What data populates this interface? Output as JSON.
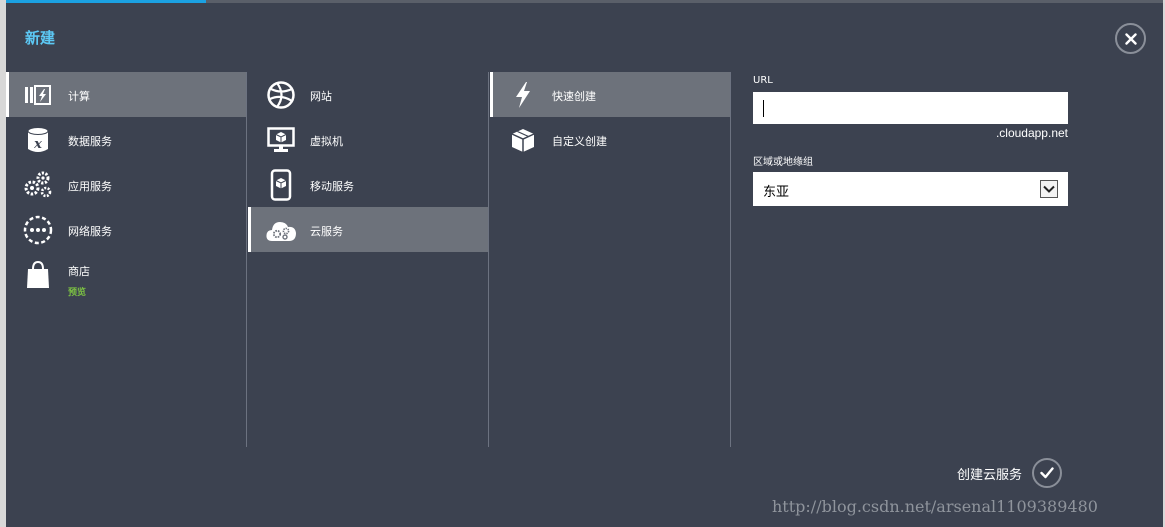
{
  "dialog": {
    "title": "新建"
  },
  "categories": [
    {
      "label": "计算",
      "icon": "compute-icon",
      "selected": true
    },
    {
      "label": "数据服务",
      "icon": "data-services-icon"
    },
    {
      "label": "应用服务",
      "icon": "app-services-icon"
    },
    {
      "label": "网络服务",
      "icon": "network-services-icon"
    },
    {
      "label": "商店",
      "sublabel": "预览",
      "icon": "store-icon"
    }
  ],
  "compute_items": [
    {
      "label": "网站",
      "icon": "website-icon"
    },
    {
      "label": "虚拟机",
      "icon": "virtual-machine-icon"
    },
    {
      "label": "移动服务",
      "icon": "mobile-services-icon"
    },
    {
      "label": "云服务",
      "icon": "cloud-services-icon",
      "selected": true
    }
  ],
  "create_options": [
    {
      "label": "快速创建",
      "icon": "quick-create-icon",
      "selected": true
    },
    {
      "label": "自定义创建",
      "icon": "custom-create-icon"
    }
  ],
  "form": {
    "url_label": "URL",
    "url_value": "",
    "url_suffix": ".cloudapp.net",
    "region_label": "区域或地缘组",
    "region_value": "东亚"
  },
  "footer": {
    "create_label": "创建云服务"
  },
  "watermark": "http://blog.csdn.net/arsenal1109389480",
  "colors": {
    "background": "#3c4250",
    "selected": "#6d727b",
    "title": "#5cc8f4",
    "preview": "#7bc043"
  }
}
